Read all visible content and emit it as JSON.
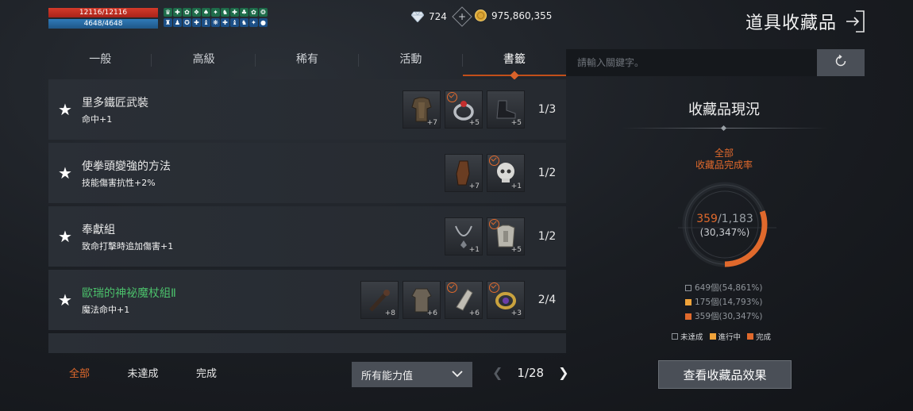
{
  "hud": {
    "hp": "12116/12116",
    "mp": "4648/4648",
    "buffs": [
      "♛",
      "✚",
      "✿",
      "❖",
      "♠",
      "✦",
      "♞",
      "✚",
      "♣",
      "✿",
      "❂",
      "♜",
      "♟",
      "✪",
      "✚",
      "♝",
      "❋",
      "✚",
      "♝",
      "♞",
      "✦",
      "●"
    ]
  },
  "currency": {
    "gems": "724",
    "gold": "975,860,355"
  },
  "header": {
    "title": "道具收藏品"
  },
  "tabs": [
    {
      "label": "一般"
    },
    {
      "label": "高級"
    },
    {
      "label": "稀有"
    },
    {
      "label": "活動"
    },
    {
      "label": "書籤"
    }
  ],
  "search": {
    "placeholder": "請輸入關鍵字。"
  },
  "collections": [
    {
      "title": "里多鐵匠武裝",
      "effect": "命中+1",
      "count": "1/3",
      "items": [
        {
          "icon": "armor-icon",
          "plus": "+7",
          "checked": false
        },
        {
          "icon": "ring-icon",
          "plus": "+5",
          "checked": true
        },
        {
          "icon": "boots-icon",
          "plus": "+5",
          "checked": false
        }
      ]
    },
    {
      "title": "使拳頭變強的方法",
      "effect": "技能傷害抗性+2%",
      "count": "1/2",
      "items": [
        {
          "icon": "gauntlet-icon",
          "plus": "+7",
          "checked": false
        },
        {
          "icon": "skull-helm-icon",
          "plus": "+1",
          "checked": true
        }
      ]
    },
    {
      "title": "奉獻組",
      "effect": "致命打擊時追加傷害+1",
      "count": "1/2",
      "items": [
        {
          "icon": "necklace-icon",
          "plus": "+1",
          "checked": false
        },
        {
          "icon": "chest-armor-icon",
          "plus": "+5",
          "checked": true
        }
      ]
    },
    {
      "title": "歐瑞的神祕魔杖組Ⅱ",
      "effect": "魔法命中+1",
      "count": "2/4",
      "items": [
        {
          "icon": "wand-icon",
          "plus": "+8",
          "checked": false
        },
        {
          "icon": "robe-icon",
          "plus": "+6",
          "checked": false
        },
        {
          "icon": "gloves-icon",
          "plus": "+6",
          "checked": true
        },
        {
          "icon": "bracelet-icon",
          "plus": "+3",
          "checked": true
        }
      ]
    }
  ],
  "filters": [
    "全部",
    "未達成",
    "完成"
  ],
  "ability_select": {
    "value": "所有能力值"
  },
  "pager": {
    "text": "1/28"
  },
  "panel": {
    "title": "收藏品現況",
    "rate_label_1": "全部",
    "rate_label_2": "收藏品完成率",
    "done": "359",
    "total": "/1,183",
    "percent": "(30,347%)",
    "completion_fraction": 0.30347,
    "progress_fraction": 0.14793,
    "stats": [
      {
        "kind": "none",
        "text": "649個(54,861%)"
      },
      {
        "kind": "prog",
        "text": "175個(14,793%)"
      },
      {
        "kind": "done",
        "text": "359個(30,347%)"
      }
    ],
    "legend": [
      "未達成",
      "進行中",
      "完成"
    ],
    "view_button": "查看收藏品效果"
  },
  "colors": {
    "accent": "#e0692c",
    "progress": "#f0a33a",
    "hp": "#d33a2a",
    "mp": "#2f7ab8",
    "green_title": "#4bbf6b"
  }
}
